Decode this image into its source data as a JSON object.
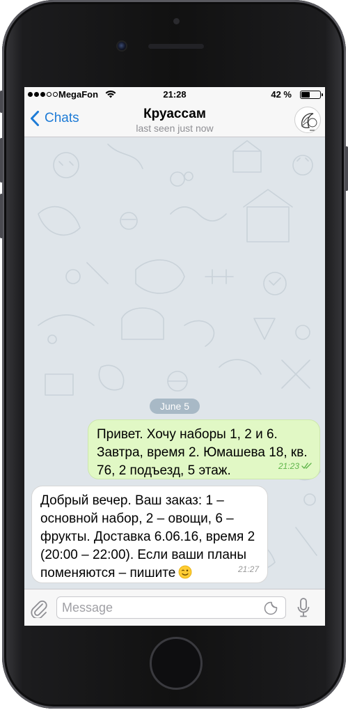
{
  "status_bar": {
    "carrier": "MegaFon",
    "time": "21:28",
    "battery": "42 %",
    "signal_bars_filled": 3,
    "signal_bars_total": 5
  },
  "nav": {
    "back_label": "Chats",
    "title": "Круассам",
    "subtitle": "last seen just now",
    "accent_color": "#1d7bd6"
  },
  "chat": {
    "date_separator": "June 5",
    "messages": [
      {
        "direction": "outgoing",
        "text": "Привет. Хочу наборы 1, 2 и 6.\nЗавтра, время 2. Юмашева 18, кв.\n76, 2 подъезд, 5 этаж.",
        "time": "21:23",
        "status_icon": "double-check-icon"
      },
      {
        "direction": "incoming",
        "text": "Добрый вечер. Ваш заказ: 1 –\nосновной набор, 2 – овощи, 6 –\nфрукты. Доставка 6.06.16, время 2\n(20:00 – 22:00). Если ваши планы\nпоменяются – пишите",
        "emoji": "winking-face-icon",
        "time": "21:27"
      }
    ]
  },
  "composer": {
    "placeholder": "Message",
    "value": ""
  },
  "colors": {
    "outgoing_bubble": "#e1f8c5",
    "incoming_bubble": "#ffffff",
    "chat_background": "#dfe5ea",
    "read_check": "#5fb54a"
  }
}
